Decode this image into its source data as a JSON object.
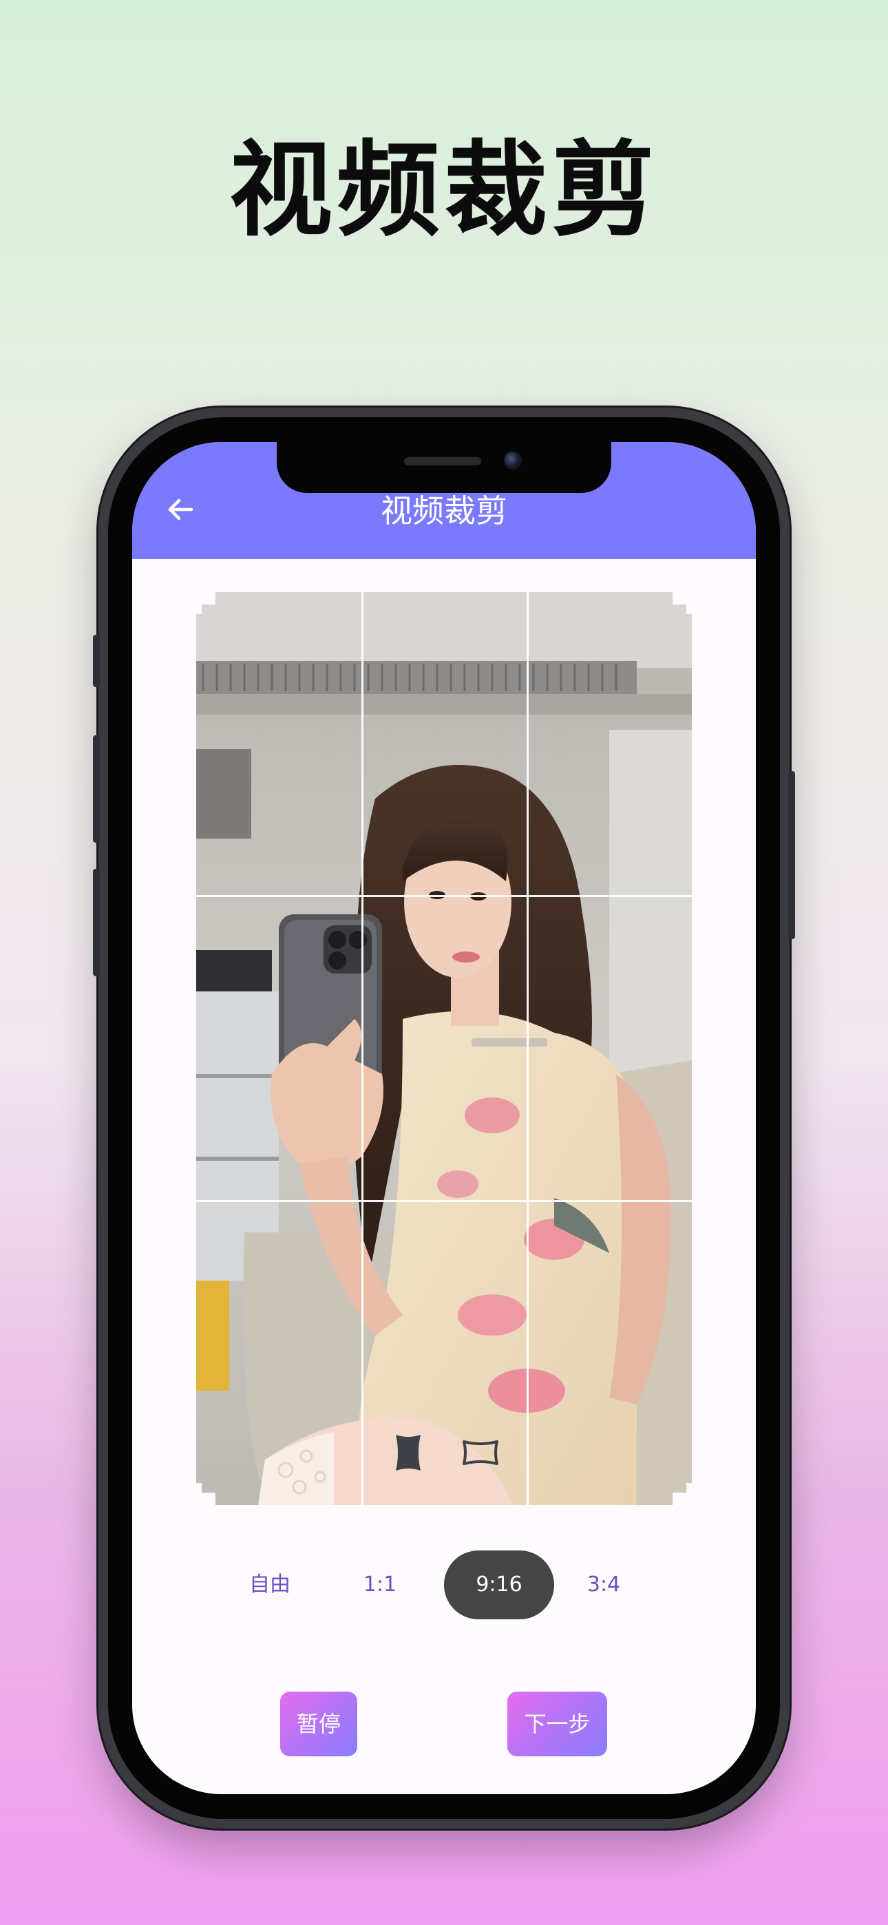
{
  "promo": {
    "headline": "视频裁剪"
  },
  "header": {
    "title": "视频裁剪",
    "back_icon": "arrow-left-icon"
  },
  "crop": {
    "grid_rows": 3,
    "grid_cols": 3
  },
  "orientation": {
    "portrait_icon": "portrait-frame-icon",
    "landscape_icon": "landscape-frame-icon"
  },
  "ratios": [
    {
      "label": "自由",
      "selected": false
    },
    {
      "label": "1:1",
      "selected": false
    },
    {
      "label": "9:16",
      "selected": true
    },
    {
      "label": "3:4",
      "selected": false
    }
  ],
  "actions": {
    "pause_label": "暂停",
    "next_label": "下一步"
  },
  "colors": {
    "header_bg": "#7b79fd",
    "ratio_text": "#6b4fc4",
    "ratio_selected_bg": "#454545",
    "button_gradient_start": "#e66cf0",
    "button_gradient_end": "#8a7cfd"
  }
}
